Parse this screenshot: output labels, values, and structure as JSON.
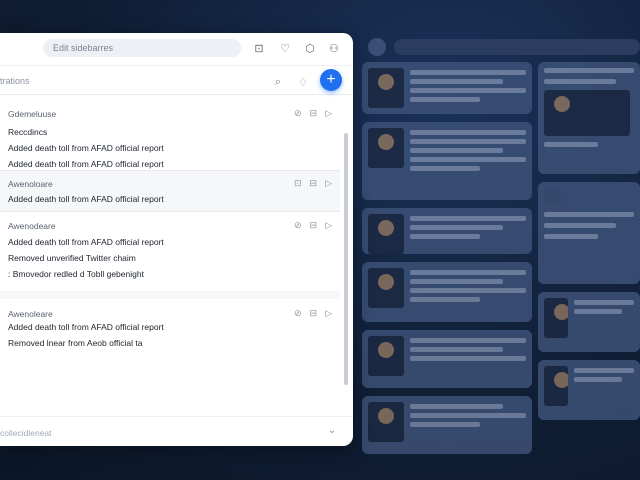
{
  "search": {
    "placeholder": "Edit sidebarres"
  },
  "topbar": {
    "icons": [
      "expand-icon",
      "heart-icon",
      "settings-icon",
      "user-icon"
    ]
  },
  "subbar": {
    "title": "trations",
    "icons": [
      "comment-icon",
      "flag-icon"
    ],
    "add_label": "+"
  },
  "groups": [
    {
      "header": "Gdemeluuse",
      "items": [
        "Reccdincs",
        "Added death toll from AFAD official report",
        "Added death toll from AFAD official report"
      ],
      "meta": [
        "⊘",
        "⊟",
        "▷"
      ]
    },
    {
      "header": "Awenoloare",
      "items": [
        "Added death toll from AFAD official report"
      ],
      "meta": [
        "⊡",
        "⊟",
        "▷"
      ]
    },
    {
      "header": "Awenodeare",
      "items": [
        "Added death toll from AFAD official report",
        "Removed unverified Twitter chaim",
        ": Bmovedor redled d  Tobll gebenight"
      ],
      "meta": [
        "⊘",
        "⊟",
        "▷"
      ]
    },
    {
      "header": "Awenoleare",
      "items": [
        "Added death toll from AFAD official report",
        "Removed lnear from Aeob official ta"
      ],
      "meta": [
        "⊘",
        "⊟",
        "▷"
      ]
    }
  ],
  "footer": {
    "text": "collecidleneat",
    "chevron": "⌄"
  },
  "colors": {
    "accent": "#1f6ff0",
    "background": "#0f1d33",
    "panel": "#ffffff"
  }
}
